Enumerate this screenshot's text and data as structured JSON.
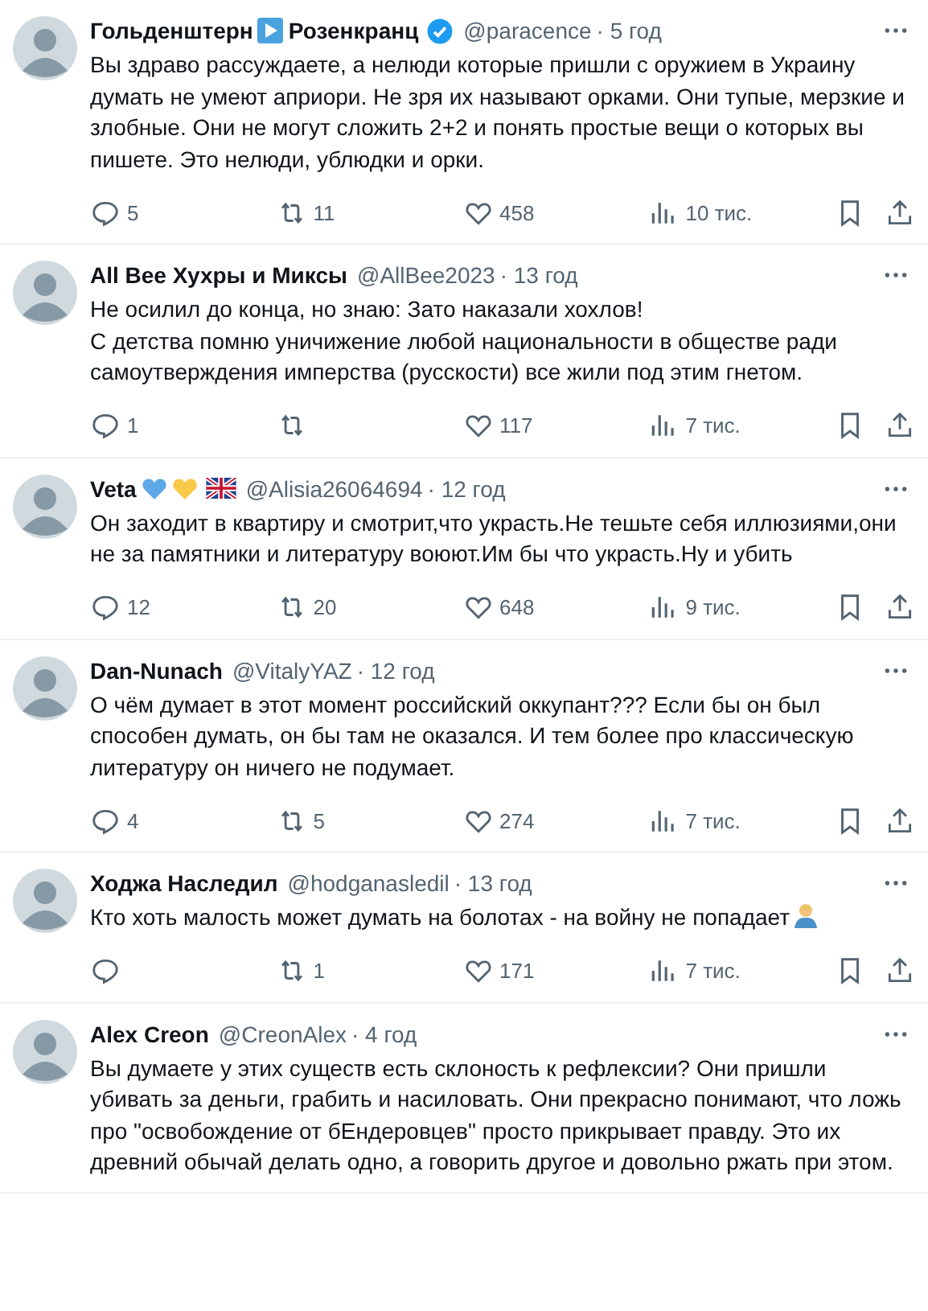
{
  "posts": [
    {
      "name_parts": [
        {
          "kind": "text",
          "text": "Гольденштерн"
        },
        {
          "kind": "play"
        },
        {
          "kind": "text",
          "text": "Розенкранц"
        }
      ],
      "verified": true,
      "handle": "@paracence",
      "time": "· 5 год",
      "body": "Вы здраво рассуждаете, а нелюди которые пришли с оружием в Украину думать не умеют априори. Не зря их называют орками. Они тупые, мерзкие и злобные. Они не могут сложить 2+2 и понять простые вещи о которых вы пишете. Это нелюди, ублюдки и орки.",
      "stats": {
        "replies": "5",
        "reposts": "11",
        "likes": "458",
        "views": "10 тис."
      }
    },
    {
      "name_parts": [
        {
          "kind": "text",
          "text": "All Bee Хухры и Миксы"
        }
      ],
      "verified": false,
      "handle": "@AllBee2023",
      "time": "· 13 год",
      "body": "Не осилил до конца, но знаю: Зато наказали хохлов!\nС детства помню уничижение любой национальности в обществе ради самоутверждения имперства (русскости) все жили под этим гнетом.",
      "stats": {
        "replies": "1",
        "likes": "117",
        "views": "7 тис."
      }
    },
    {
      "name_parts": [
        {
          "kind": "text",
          "text": "Veta"
        },
        {
          "kind": "heart",
          "color": "#5ea8e8"
        },
        {
          "kind": "heart",
          "color": "#f7c948"
        },
        {
          "kind": "flag"
        }
      ],
      "verified": false,
      "handle": "@Alisia26064694",
      "time": "· 12 год",
      "body": "Он заходит в квартиру и смотрит,что украсть.Не тешьте себя иллюзиями,они не за памятники и литературу воюют.Им бы что украсть.Ну и убить",
      "stats": {
        "replies": "12",
        "reposts": "20",
        "likes": "648",
        "views": "9 тис."
      }
    },
    {
      "name_parts": [
        {
          "kind": "text",
          "text": "Dan-Nunach"
        }
      ],
      "verified": false,
      "handle": "@VitalyYAZ",
      "time": "· 12 год",
      "body": "О чём думает в этот момент российский оккупант??? Если бы он был способен думать, он бы там не оказался. И тем более про классическую литературу он ничего не подумает.",
      "stats": {
        "replies": "4",
        "reposts": "5",
        "likes": "274",
        "views": "7 тис."
      }
    },
    {
      "name_parts": [
        {
          "kind": "text",
          "text": "Ходжа Наследил"
        }
      ],
      "verified": false,
      "handle": "@hodganasledil",
      "time": "· 13 год",
      "body": "Кто хоть малость может думать на болотах - на войну не попадает",
      "ends_with_emoji": true,
      "stats": {
        "reposts": "1",
        "likes": "171",
        "views": "7 тис."
      }
    },
    {
      "name_parts": [
        {
          "kind": "text",
          "text": "Alex Creon"
        }
      ],
      "verified": false,
      "handle": "@CreonAlex",
      "time": "· 4 год",
      "body": "Вы думаете у этих существ есть склоность к рефлексии? Они пришли убивать за деньги, грабить и насиловать. Они прекрасно понимают, что ложь про \"освобождение от бЕндеровцев\" просто прикрывает правду. Это их древний обычай делать одно, а говорить другое и довольно ржать при этом."
    }
  ]
}
